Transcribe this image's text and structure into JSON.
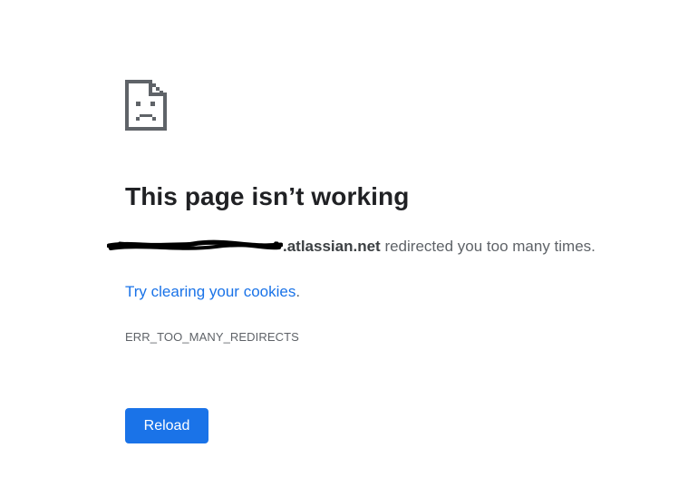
{
  "icon": "sad-page-icon",
  "heading": "This page isn’t working",
  "message": {
    "domain_suffix": ".atlassian.net",
    "text": " redirected you too many times."
  },
  "suggestion": {
    "link_text": "Try clearing your cookies",
    "trailing": "."
  },
  "error_code": "ERR_TOO_MANY_REDIRECTS",
  "reload_label": "Reload",
  "colors": {
    "link": "#1a73e8",
    "button": "#1a73e8",
    "heading": "#202124",
    "body_text": "#5f6368"
  }
}
